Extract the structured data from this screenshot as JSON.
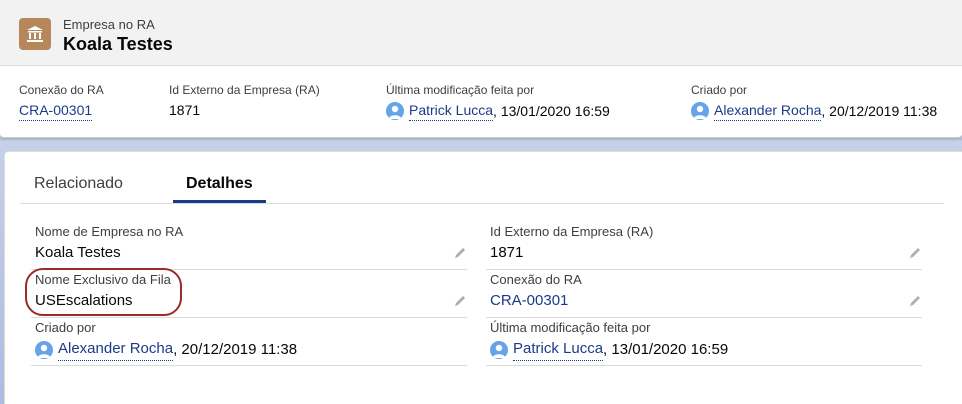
{
  "header": {
    "entity_type": "Empresa no RA",
    "title": "Koala Testes",
    "entity_icon": "building-icon",
    "brand_color": "#b5875a"
  },
  "highlights": [
    {
      "label": "Conexão do RA",
      "value": "CRA-00301"
    },
    {
      "label": "Id Externo da Empresa (RA)",
      "value": "1871"
    },
    {
      "label": "Última modificação feita por",
      "user": "Patrick Lucca",
      "date": ", 13/01/2020 16:59"
    },
    {
      "label": "Criado por",
      "user": "Alexander Rocha",
      "date": ", 20/12/2019 11:38"
    }
  ],
  "tabs": [
    {
      "label": "Relacionado",
      "active": false
    },
    {
      "label": "Detalhes",
      "active": true
    }
  ],
  "details": {
    "left": [
      {
        "label": "Nome de Empresa no RA",
        "value": "Koala Testes"
      },
      {
        "label": "Nome Exclusivo da Fila",
        "value": "USEscalations"
      },
      {
        "label": "Criado por",
        "user": "Alexander Rocha",
        "date": ", 20/12/2019 11:38"
      }
    ],
    "right": [
      {
        "label": "Id Externo da Empresa (RA)",
        "value": "1871"
      },
      {
        "label": "Conexão do RA",
        "value": "CRA-00301"
      },
      {
        "label": "Última modificação feita por",
        "user": "Patrick Lucca",
        "date": ", 13/01/2020 16:59"
      }
    ]
  },
  "colors": {
    "link": "#1b3a8a",
    "highlight_outline": "#9b2a2a",
    "avatar": "#65a3ea"
  }
}
